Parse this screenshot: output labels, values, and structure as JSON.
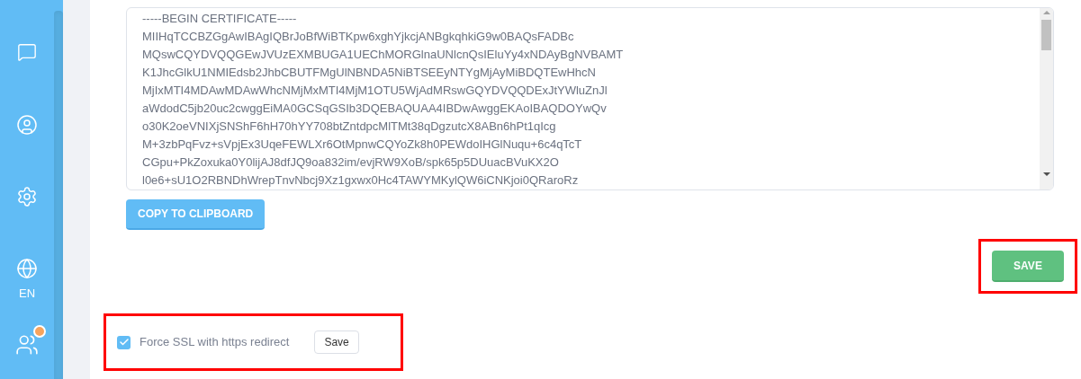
{
  "sidebar": {
    "language": "EN",
    "users_notification": true
  },
  "certificate": {
    "lines": [
      "-----BEGIN CERTIFICATE-----",
      "MIIHqTCCBZGgAwIBAgIQBrJoBfWiBTKpw6xghYjkcjANBgkqhkiG9w0BAQsFADBc",
      "MQswCQYDVQQGEwJVUzEXMBUGA1UEChMORGlnaUNlcnQsIEluYy4xNDAyBgNVBAMT",
      "K1JhcGlkU1NMIEdsb2JhbCBUTFMgUlNBNDA5NiBTSEEyNTYgMjAyMiBDQTEwHhcN",
      "MjIxMTI4MDAwMDAwWhcNMjMxMTI4MjM1OTU5WjAdMRswGQYDVQQDExJtYWluZnJl",
      "aWdodC5jb20uc2cwggEiMA0GCSqGSIb3DQEBAQUAA4IBDwAwggEKAoIBAQDOYwQv",
      "o30K2oeVNIXjSNShF6hH70hYY708btZntdpcMlTMt38qDgzutcX8ABn6hPt1qIcg",
      "M+3zbPqFvz+sVpjEx3UqeFEWLXr6OtMpnwCQYoZk8h0PEWdoIHGlNuqu+6c4qTcT",
      "CGpu+PkZoxuka0Y0lijAJ8dfJQ9oa832im/evjRW9XoB/spk65p5DUuacBVuKX2O",
      "l0e6+sU1O2RBNDhWrepTnvNbcj9Xz1gxwx0Hc4TAWYMKylQW6iCNKjoi0QRaroRz"
    ]
  },
  "copy_button": "COPY TO CLIPBOARD",
  "save_button": "SAVE",
  "force_ssl": {
    "label": "Force SSL with https redirect",
    "checked": true,
    "button": "Save"
  }
}
